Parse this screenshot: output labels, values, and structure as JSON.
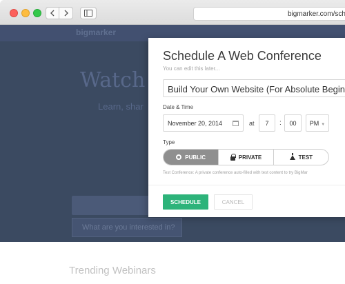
{
  "browser": {
    "address": "bigmarker.com/sch"
  },
  "background": {
    "logo": "bigmarker",
    "hero_title": "Watch o",
    "hero_subtitle": "Learn, shar",
    "search_placeholder": "What are you interested in?",
    "trending_heading": "Trending Webinars"
  },
  "modal": {
    "title": "Schedule A Web Conference",
    "subtitle": "You can edit this later...",
    "conference_title": "Build Your Own Website (For Absolute Beginners)",
    "date_time_label": "Date & Time",
    "date": "November 20, 2014",
    "at_label": "at",
    "hour": "7",
    "colon": ":",
    "minute": "00",
    "ampm": "PM",
    "type_label": "Type",
    "types": [
      "PUBLIC",
      "PRIVATE",
      "TEST"
    ],
    "selected_type": "PUBLIC",
    "type_note": "Test Conference: A private conference auto-filled with test content to try BigMar",
    "schedule_button": "SCHEDULE",
    "cancel_button": "CANCEL"
  },
  "colors": {
    "accent_green": "#2db37a",
    "selected_segment": "#8f8f8f",
    "hero_background": "#3b4a61"
  }
}
